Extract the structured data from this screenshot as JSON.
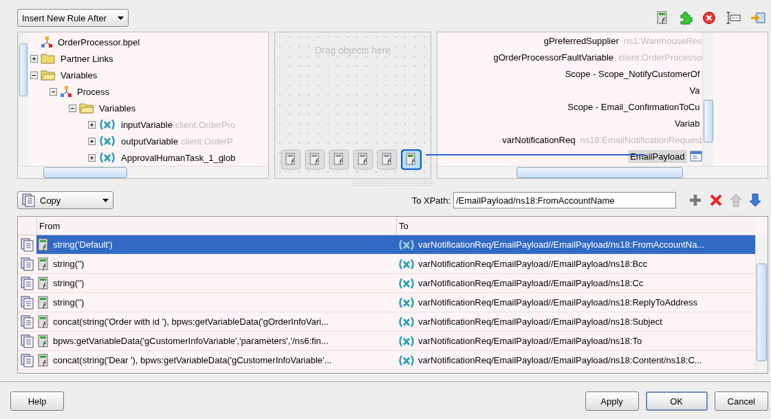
{
  "rule_dropdown": {
    "value": "Insert New Rule After"
  },
  "source_tree": {
    "items": [
      {
        "label": "OrderProcessor.bpel",
        "kind": "process"
      },
      {
        "label": "Partner Links",
        "kind": "folder",
        "expanded": false
      },
      {
        "label": "Variables",
        "kind": "folder",
        "expanded": true,
        "children": [
          {
            "label": "Process",
            "kind": "process",
            "expanded": true,
            "children": [
              {
                "label": "Variables",
                "kind": "folder",
                "expanded": true,
                "children": [
                  {
                    "label": "inputVariable",
                    "type": "client:OrderPro",
                    "kind": "variable",
                    "expanded": false
                  },
                  {
                    "label": "outputVariable",
                    "type": "client:OrderP",
                    "kind": "variable",
                    "expanded": false
                  },
                  {
                    "label": "ApprovalHumanTask_1_glob",
                    "kind": "variable",
                    "expanded": false
                  }
                ]
              }
            ]
          }
        ]
      }
    ]
  },
  "function_area": {
    "placeholder": "Drag objects here",
    "functions": [
      {
        "selected": false
      },
      {
        "selected": false
      },
      {
        "selected": false
      },
      {
        "selected": false
      },
      {
        "selected": false
      },
      {
        "selected": true
      }
    ]
  },
  "target_tree": {
    "items": [
      {
        "label": "gPreferredSupplier",
        "type": "ns1:WarehouseRes",
        "selected": false
      },
      {
        "label": "gOrderProcessorFaultVariable",
        "type": "client:OrderProcesso",
        "selected": false
      },
      {
        "label": "Scope - Scope_NotifyCustomerOf",
        "selected": false
      },
      {
        "label": "Va",
        "selected": false
      },
      {
        "label": "Scope - Email_ConfirmationToCu",
        "selected": false
      },
      {
        "label": "Variab",
        "selected": false
      },
      {
        "label": "varNotificationReq",
        "type": "ns18:EmailNotificationRequest",
        "selected": false
      },
      {
        "label": "EmailPayload",
        "selected": true
      }
    ]
  },
  "operation_dropdown": {
    "value": "Copy"
  },
  "to_xpath": {
    "label": "To XPath:",
    "value": "/EmailPayload/ns18:FromAccountName"
  },
  "table": {
    "columns": [
      "From",
      "To"
    ],
    "rows": [
      {
        "from": "string('Default')",
        "to": "varNotificationReq/EmailPayload//EmailPayload/ns18:FromAccountNa...",
        "selected": true
      },
      {
        "from": "string('')",
        "to": "varNotificationReq/EmailPayload//EmailPayload/ns18:Bcc",
        "selected": false
      },
      {
        "from": "string('')",
        "to": "varNotificationReq/EmailPayload//EmailPayload/ns18:Cc",
        "selected": false
      },
      {
        "from": "string('')",
        "to": "varNotificationReq/EmailPayload//EmailPayload/ns18:ReplyToAddress",
        "selected": false
      },
      {
        "from": "concat(string('Order with id '), bpws:getVariableData('gOrderInfoVari...",
        "to": "varNotificationReq/EmailPayload//EmailPayload/ns18:Subject",
        "selected": false
      },
      {
        "from": "bpws:getVariableData('gCustomerInfoVariable','parameters','/ns6:fin...",
        "to": "varNotificationReq/EmailPayload//EmailPayload/ns18:To",
        "selected": false
      },
      {
        "from": "concat(string('Dear '), bpws:getVariableData('gCustomerInfoVariable'...",
        "to": "varNotificationReq/EmailPayload//EmailPayload/ns18:Content/ns18:C...",
        "selected": false
      }
    ]
  },
  "buttons": [
    {
      "label": "Help",
      "kind": "plain"
    },
    {
      "label": "Apply",
      "kind": "plain"
    },
    {
      "label": "OK",
      "kind": "default"
    },
    {
      "label": "Cancel",
      "kind": "plain"
    }
  ]
}
